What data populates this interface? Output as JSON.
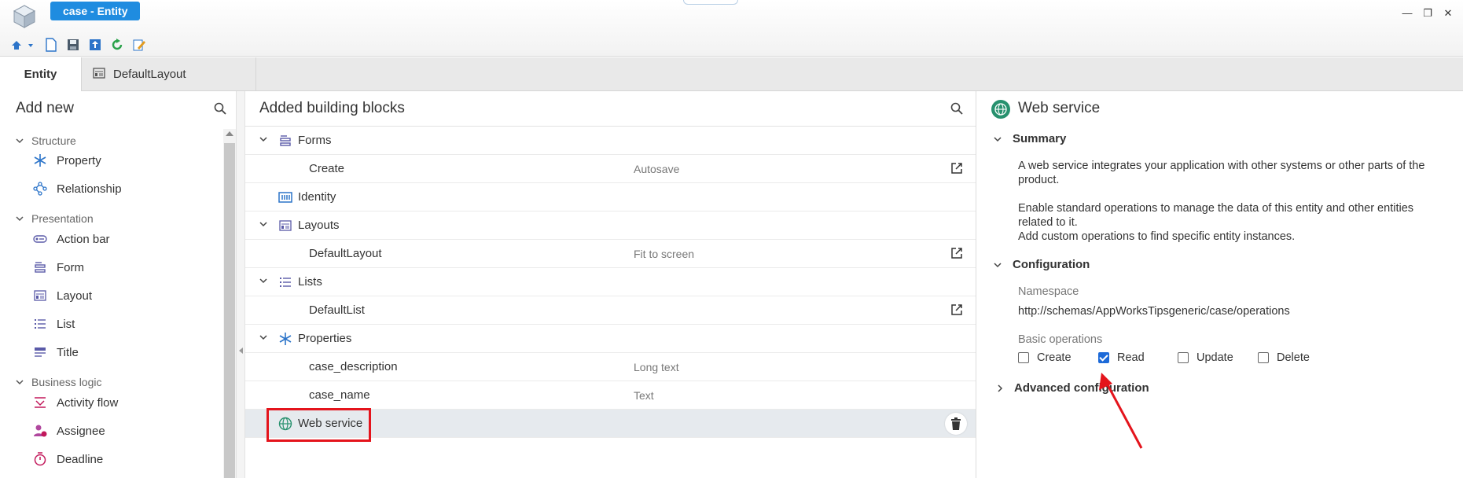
{
  "window": {
    "doc_badge": "case - Entity",
    "minimize": "—",
    "restore": "❐",
    "close": "✕"
  },
  "toolbar": {
    "icons": [
      "publish-dropdown-icon",
      "new-document-icon",
      "save-icon",
      "export-icon",
      "refresh-icon",
      "edit-icon"
    ]
  },
  "tabs": [
    {
      "label": "Entity",
      "active": true
    },
    {
      "label": "DefaultLayout",
      "active": false
    }
  ],
  "left_panel": {
    "title": "Add new",
    "sections": [
      {
        "label": "Structure",
        "items": [
          {
            "label": "Property",
            "icon": "asterisk-icon"
          },
          {
            "label": "Relationship",
            "icon": "relationship-icon"
          }
        ]
      },
      {
        "label": "Presentation",
        "items": [
          {
            "label": "Action bar",
            "icon": "action-bar-icon"
          },
          {
            "label": "Form",
            "icon": "form-icon"
          },
          {
            "label": "Layout",
            "icon": "layout-icon"
          },
          {
            "label": "List",
            "icon": "list-icon"
          },
          {
            "label": "Title",
            "icon": "title-icon"
          }
        ]
      },
      {
        "label": "Business logic",
        "items": [
          {
            "label": "Activity flow",
            "icon": "activity-flow-icon"
          },
          {
            "label": "Assignee",
            "icon": "assignee-icon"
          },
          {
            "label": "Deadline",
            "icon": "deadline-icon"
          }
        ]
      }
    ]
  },
  "middle_panel": {
    "title": "Added building blocks",
    "rows": [
      {
        "label": "Forms",
        "value": "",
        "level": 0
      },
      {
        "label": "Create",
        "value": "Autosave",
        "level": 1
      },
      {
        "label": "Identity",
        "value": "",
        "level": 0
      },
      {
        "label": "Layouts",
        "value": "",
        "level": 0
      },
      {
        "label": "DefaultLayout",
        "value": "Fit to screen",
        "level": 1
      },
      {
        "label": "Lists",
        "value": "",
        "level": 0
      },
      {
        "label": "DefaultList",
        "value": "",
        "level": 1
      },
      {
        "label": "Properties",
        "value": "",
        "level": 0
      },
      {
        "label": "case_description",
        "value": "Long text",
        "level": 1
      },
      {
        "label": "case_name",
        "value": "Text",
        "level": 1
      },
      {
        "label": "Web service",
        "value": "",
        "level": 0,
        "selected": true
      }
    ]
  },
  "right_panel": {
    "title": "Web service",
    "summary": {
      "heading": "Summary",
      "p1": "A web service integrates your application with other systems or other parts of the product.",
      "p2": "Enable standard operations to manage the data of this entity and other entities related to it.",
      "p3": "Add custom operations to find specific entity instances."
    },
    "configuration": {
      "heading": "Configuration",
      "namespace_label": "Namespace",
      "namespace_value": "http://schemas/AppWorksTipsgeneric/case/operations",
      "basic_ops_label": "Basic operations",
      "ops": [
        {
          "label": "Create",
          "checked": false
        },
        {
          "label": "Read",
          "checked": true
        },
        {
          "label": "Update",
          "checked": false
        },
        {
          "label": "Delete",
          "checked": false
        }
      ]
    },
    "advanced": {
      "heading": "Advanced configuration"
    }
  },
  "colors": {
    "badge": "#1f8ce0",
    "accent": "#1d6ad8",
    "icon_purple": "#5a5aa8",
    "globe_green": "#27916e",
    "annotation_red": "#e4141c"
  }
}
